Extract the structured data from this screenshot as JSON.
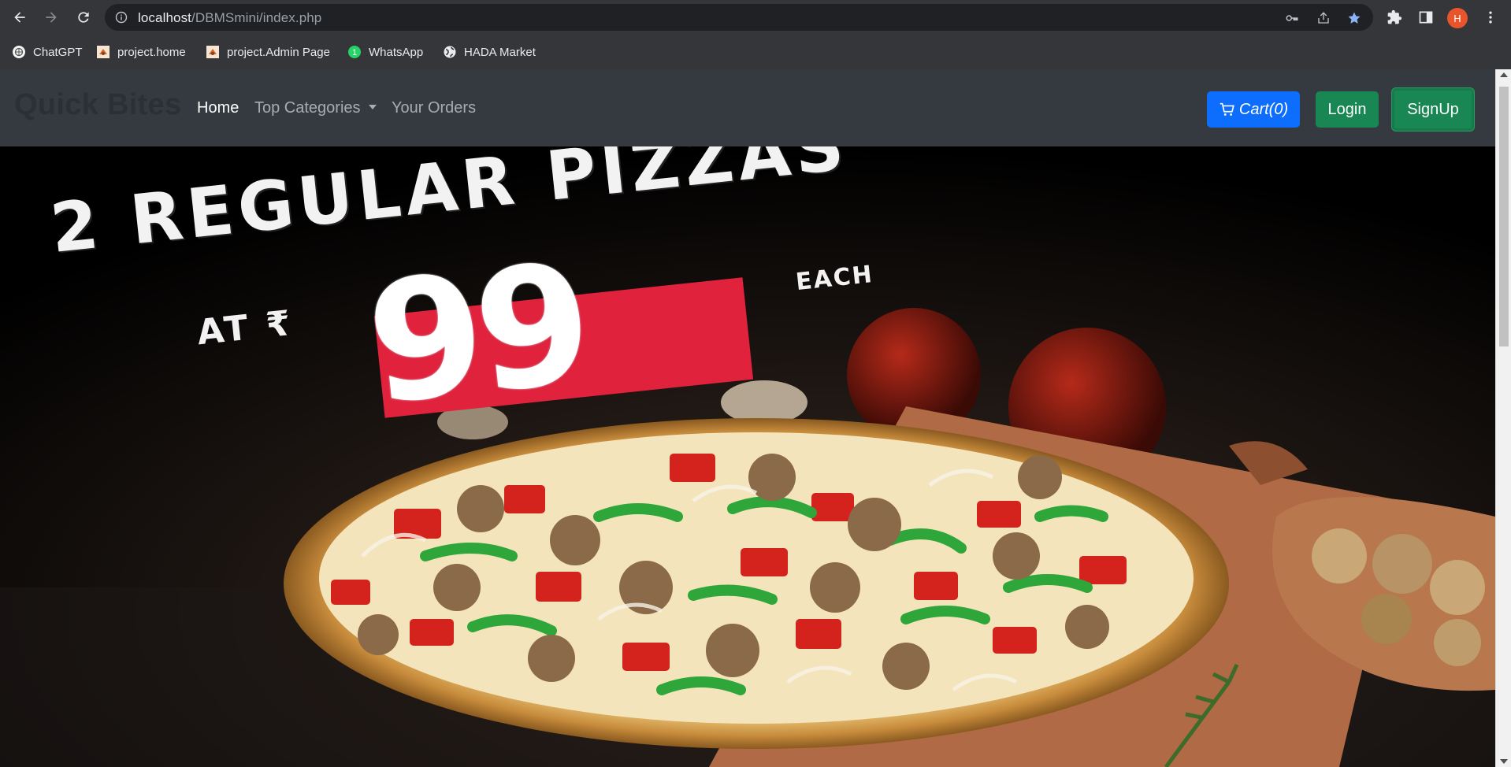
{
  "browser": {
    "url_host": "localhost",
    "url_path": "/DBMSmini/index.php",
    "profile_initial": "H",
    "bookmarks": [
      {
        "label": "ChatGPT",
        "icon": "chatgpt-icon"
      },
      {
        "label": "project.home",
        "icon": "page-favicon"
      },
      {
        "label": "project.Admin Page",
        "icon": "page-favicon"
      },
      {
        "label": "WhatsApp",
        "icon": "whatsapp-icon"
      },
      {
        "label": "HADA Market",
        "icon": "globe-icon"
      }
    ],
    "whatsapp_badge": "1"
  },
  "site": {
    "brand": "Quick Bites",
    "nav": {
      "home": "Home",
      "categories": "Top Categories",
      "orders": "Your Orders"
    },
    "buttons": {
      "cart": "Cart(0)",
      "login": "Login",
      "signup": "SignUp"
    }
  },
  "hero": {
    "line1": "2 REGULAR PIZZAS",
    "at": "AT ₹",
    "price": "99",
    "each": "EACH"
  },
  "colors": {
    "chrome": "#35363a",
    "omnibox": "#202124",
    "navbar": "#343a40",
    "primary": "#0d6efd",
    "success": "#198754",
    "promo_red": "#e0223d"
  }
}
